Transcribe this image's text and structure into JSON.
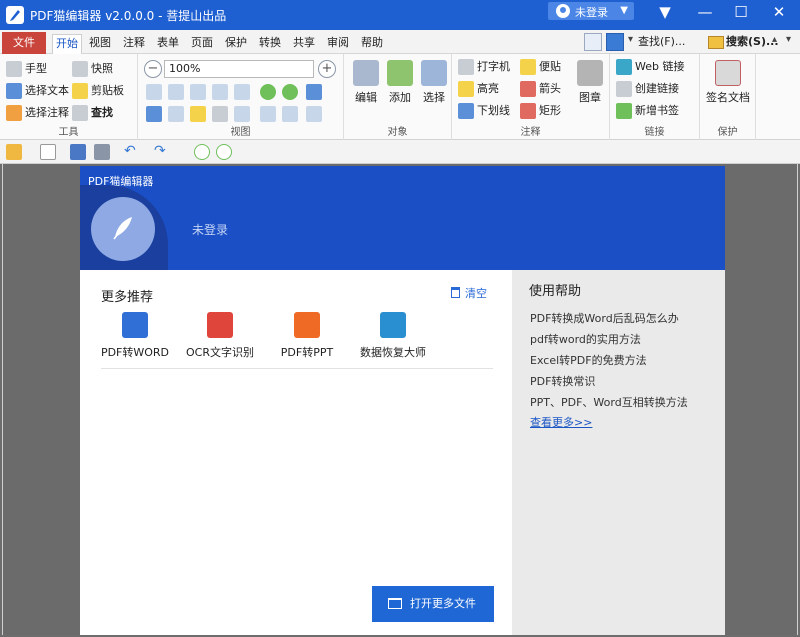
{
  "window": {
    "title": "PDF猫编辑器 v2.0.0.0 - 菩提山出品",
    "login_label": "未登录"
  },
  "menu": {
    "file": "文件",
    "tabs": [
      "开始",
      "视图",
      "注释",
      "表单",
      "页面",
      "保护",
      "转换",
      "共享",
      "审阅",
      "帮助"
    ],
    "active_tab": "开始",
    "find_label": "查找(F)...",
    "search_label": "搜索(S)..."
  },
  "ribbon": {
    "tools": {
      "label": "工具",
      "hand": "手型",
      "snapshot": "快照",
      "select_text": "选择文本",
      "clipboard": "剪贴板",
      "select_annot": "选择注释",
      "find": "查找"
    },
    "view": {
      "label": "视图",
      "zoom": "100%"
    },
    "object": {
      "label": "对象",
      "edit": "编辑",
      "add": "添加",
      "select": "选择"
    },
    "annotate": {
      "label": "注释",
      "typewriter": "打字机",
      "sticky": "便贴",
      "highlight": "高亮",
      "arrow": "箭头",
      "underline": "下划线",
      "rectangle": "矩形",
      "stamp": "图章"
    },
    "link": {
      "label": "链接",
      "web_link": "Web 链接",
      "create_link": "创建链接",
      "bookmark": "新增书签"
    },
    "protect": {
      "label": "保护",
      "sign": "签名文档"
    }
  },
  "panel": {
    "title": "PDF猫编辑器",
    "login_status": "未登录",
    "more_title": "更多推荐",
    "clear_label": "清空",
    "apps": [
      {
        "label": "PDF转WORD",
        "color": "#2f6fd6"
      },
      {
        "label": "OCR文字识别",
        "color": "#e0453c"
      },
      {
        "label": "PDF转PPT",
        "color": "#ef6a25"
      },
      {
        "label": "数据恢复大师",
        "color": "#2a8fd1"
      }
    ],
    "open_more": "打开更多文件",
    "help_title": "使用帮助",
    "help_items": [
      "PDF转换成Word后乱码怎么办",
      "pdf转word的实用方法",
      "Excel转PDF的免费方法",
      "PDF转换常识",
      "PPT、PDF、Word互相转换方法"
    ],
    "more_link": "查看更多>>"
  }
}
